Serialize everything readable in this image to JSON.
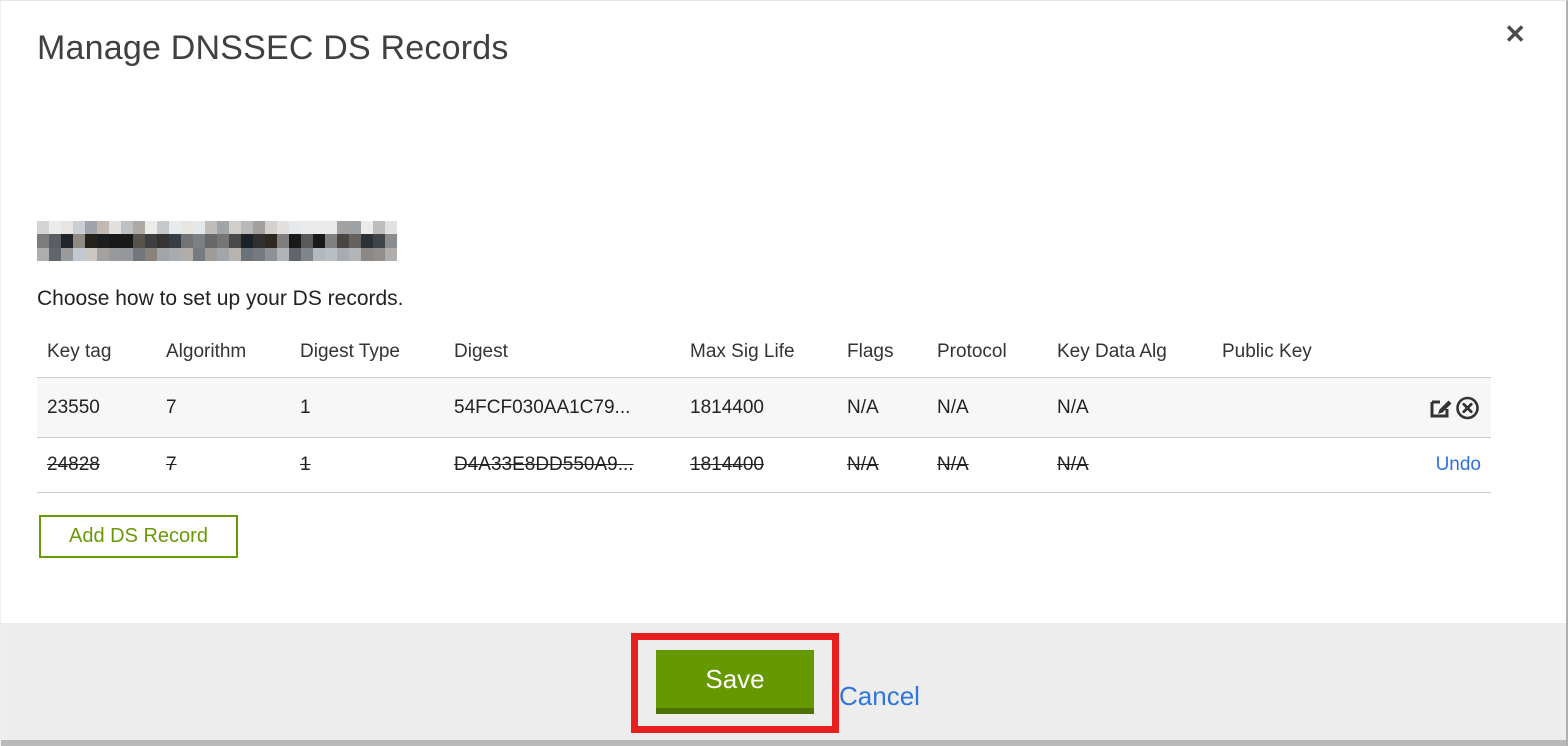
{
  "modal": {
    "title": "Manage DNSSEC DS Records",
    "close_glyph": "✕",
    "subtitle": "Choose how to set up your DS records.",
    "domain_redacted": true
  },
  "table": {
    "columns": [
      "Key tag",
      "Algorithm",
      "Digest Type",
      "Digest",
      "Max Sig Life",
      "Flags",
      "Protocol",
      "Key Data Alg",
      "Public Key"
    ],
    "rows": [
      {
        "key_tag": "23550",
        "algorithm": "7",
        "digest_type": "1",
        "digest": "54FCF030AA1C79...",
        "max_sig_life": "1814400",
        "flags": "N/A",
        "protocol": "N/A",
        "key_data_alg": "N/A",
        "public_key": "",
        "struck_through": false,
        "action_icons": [
          "edit-icon",
          "delete-circle-x-icon"
        ]
      },
      {
        "key_tag": "24828",
        "algorithm": "7",
        "digest_type": "1",
        "digest": "D4A33E8DD550A9...",
        "max_sig_life": "1814400",
        "flags": "N/A",
        "protocol": "N/A",
        "key_data_alg": "N/A",
        "public_key": "",
        "struck_through": true,
        "action_label": "Undo"
      }
    ]
  },
  "buttons": {
    "add_ds_record": "Add DS Record",
    "save": "Save",
    "cancel": "Cancel"
  },
  "colors": {
    "accent_green": "#669900",
    "outline_green": "#6a9908",
    "link_blue": "#2d77dc",
    "annotation_red": "#e81f1f",
    "footer_gray": "#ededed"
  }
}
